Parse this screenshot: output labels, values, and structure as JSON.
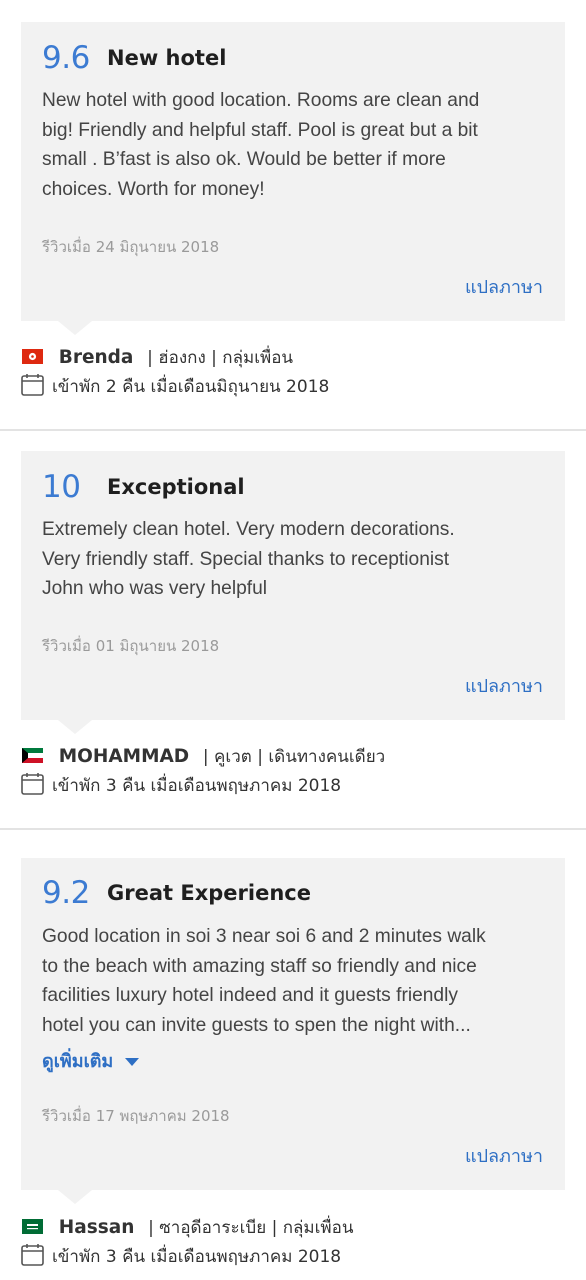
{
  "reviews": [
    {
      "score": "9.6",
      "title": "New hotel",
      "body": [
        "New hotel with good location. Rooms are clean and",
        "big! Friendly and helpful staff. Pool is great but a bit",
        "small . B’fast is also ok. Would be better if more",
        "choices. Worth for money!"
      ],
      "date": "รีวิวเมื่อ 24 มิถุนายน 2018",
      "translate": "แปลภาษา",
      "reviewer_name": "Brenda",
      "reviewer_meta": "| ฮ่องกง | กลุ่มเพื่อน",
      "flag": "hong-kong-flag",
      "stay": "เข้าพัก 2 คืน เมื่อเดือนมิถุนายน 2018"
    },
    {
      "score": "10",
      "title": "Exceptional",
      "body": [
        "Extremely clean hotel. Very modern decorations.",
        "Very friendly staff. Special thanks to receptionist",
        "John who was very helpful"
      ],
      "date": "รีวิวเมื่อ 01 มิถุนายน 2018",
      "translate": "แปลภาษา",
      "reviewer_name": "MOHAMMAD",
      "reviewer_meta": "| คูเวต | เดินทางคนเดียว",
      "flag": "kuwait-flag",
      "stay": "เข้าพัก 3 คืน เมื่อเดือนพฤษภาคม 2018"
    },
    {
      "score": "9.2",
      "title": "Great Experience",
      "body": [
        "Good location in soi 3 near soi 6 and 2 minutes walk",
        "to the beach with amazing staff so friendly and nice",
        "facilities luxury hotel indeed and it guests friendly",
        "hotel you can invite guests to spen the night with..."
      ],
      "more": "ดูเพิ่มเติม",
      "date": "รีวิวเมื่อ 17 พฤษภาคม 2018",
      "translate": "แปลภาษา",
      "reviewer_name": "Hassan",
      "reviewer_meta": "| ซาอุดีอาระเบีย | กลุ่มเพื่อน",
      "flag": "saudi-arabia-flag",
      "stay": "เข้าพัก 3 คืน เมื่อเดือนพฤษภาคม 2018"
    }
  ],
  "colors": {
    "score": "#3c7bd2",
    "link": "#2e6fc4",
    "card": "#f2f2f2",
    "divider": "#e3e3e3"
  }
}
